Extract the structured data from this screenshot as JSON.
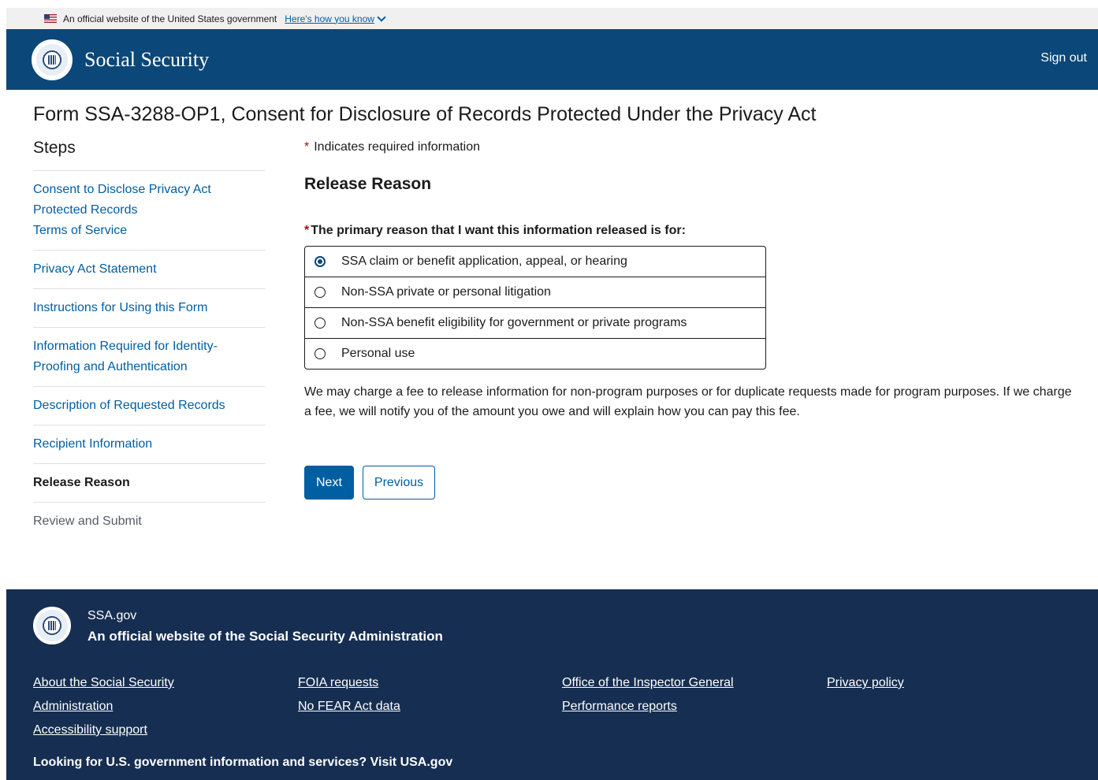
{
  "gov_banner": {
    "text": "An official website of the United States government",
    "link": "Here's how you know"
  },
  "header": {
    "brand": "Social Security",
    "sign_out": "Sign out"
  },
  "page_title": "Form SSA-3288-OP1, Consent for Disclosure of Records Protected Under the Privacy Act",
  "steps": {
    "title": "Steps",
    "items": [
      {
        "line1": "Consent to Disclose Privacy Act",
        "line2": "Protected Records",
        "line3": "Terms of Service"
      },
      {
        "label": "Privacy Act Statement"
      },
      {
        "label": "Instructions for Using this Form"
      },
      {
        "line1": "Information Required for Identity-",
        "line2": "Proofing and Authentication"
      },
      {
        "label": "Description of Requested Records"
      },
      {
        "label": "Recipient Information"
      },
      {
        "label": "Release Reason"
      },
      {
        "label": "Review and Submit"
      }
    ]
  },
  "form": {
    "required_marker": "*",
    "required_note": "Indicates required information",
    "section_title": "Release Reason",
    "question": "The primary reason that I want this information released is for:",
    "options": [
      {
        "label": "SSA claim or benefit application, appeal, or hearing",
        "checked": true
      },
      {
        "label": "Non-SSA private or personal litigation",
        "checked": false
      },
      {
        "label": "Non-SSA benefit eligibility for government or private programs",
        "checked": false
      },
      {
        "label": "Personal use",
        "checked": false
      }
    ],
    "fee_note": "We may charge a fee to release information for non-program purposes or for duplicate requests made for program purposes.  If we charge a fee, we will notify you of the amount you owe and will explain how you can pay this fee.",
    "next_label": "Next",
    "previous_label": "Previous"
  },
  "footer": {
    "site": "SSA.gov",
    "official": "An official website of the Social Security Administration",
    "links": {
      "col1": [
        "About the Social Security Administration",
        "Accessibility support"
      ],
      "col2": [
        "FOIA requests",
        "No FEAR Act data"
      ],
      "col3": [
        "Office of the Inspector General",
        "Performance reports"
      ],
      "col4": [
        "Privacy policy"
      ]
    },
    "bottom_text": "Looking for U.S. government information and services?",
    "bottom_link": "Visit USA.gov"
  },
  "colors": {
    "header_bg": "#0b4778",
    "footer_bg": "#162e51",
    "link": "#005ea2",
    "required": "#b50909"
  },
  "icons": [
    "us-flag-icon",
    "chevron-down-icon",
    "ssa-seal-icon",
    "radio-icon"
  ]
}
